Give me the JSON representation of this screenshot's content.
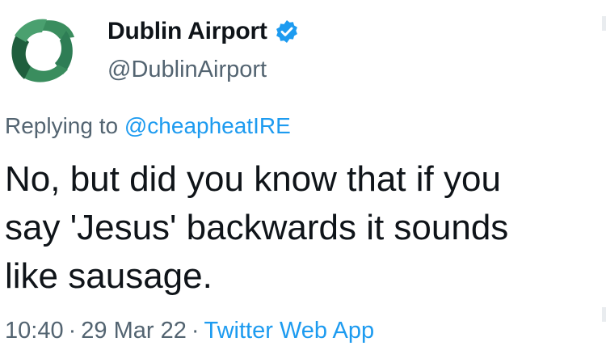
{
  "tweet": {
    "display_name": "Dublin Airport",
    "handle": "@DublinAirport",
    "verified_icon": "verified-badge-icon",
    "avatar_icon": "dublin-airport-logo-icon",
    "reply": {
      "prefix": "Replying to",
      "to_handle": "@cheapheatIRE"
    },
    "body_lines": [
      "No, but did you know that if you",
      "say 'Jesus' backwards it sounds",
      "like sausage."
    ],
    "time": "10:40",
    "date": "29 Mar 22",
    "separator": "·",
    "source": "Twitter Web App"
  },
  "colors": {
    "text": "#0f1419",
    "secondary": "#536471",
    "link": "#1d9bf0",
    "logo_green": "#2e7d55",
    "logo_dark_green": "#1f5e3d"
  }
}
